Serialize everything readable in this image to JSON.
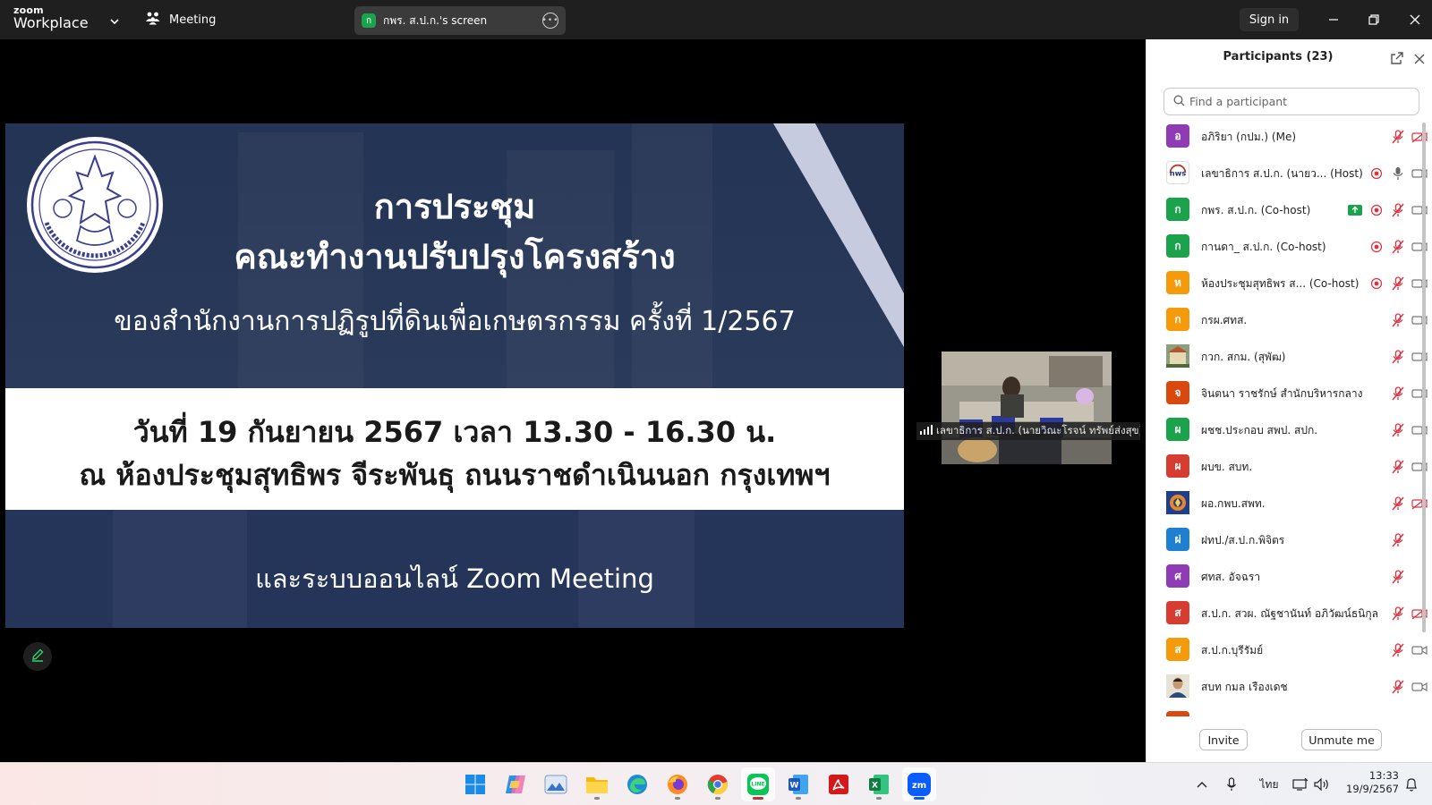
{
  "titlebar": {
    "brand_line1": "zoom",
    "brand_line2": "Workplace",
    "meeting_label": "Meeting",
    "share_avatar": "ก",
    "share_label": "กพร. ส.ป.ก.'s screen",
    "signin_label": "Sign in"
  },
  "slide": {
    "title_line1": "การประชุม",
    "title_line2": "คณะทำงานปรับปรุงโครงสร้าง",
    "subtitle": "ของสำนักงานการปฏิรูปที่ดินเพื่อเกษตรกรรม ครั้งที่ 1/2567",
    "date_line": "วันที่ 19 กันยายน 2567 เวลา 13.30 - 16.30 น.",
    "venue_line": "ณ ห้องประชุมสุทธิพร จีระพันธุ ถนนราชดำเนินนอก กรุงเทพฯ",
    "online_line": "และระบบออนไลน์ Zoom Meeting",
    "seal_caption": "สำนักงานการปฏิรูปที่ดินเพื่อเกษตรกรรม"
  },
  "thumbnail": {
    "name": "เลขาธิการ ส.ป.ก. (นายวิณะโรจน์ ทรัพย์ส่งสุข)"
  },
  "participants": {
    "title": "Participants (23)",
    "search_placeholder": "Find a participant",
    "invite_label": "Invite",
    "unmute_label": "Unmute me",
    "items": [
      {
        "initial": "อ",
        "color": "#8e3bb5",
        "name": "อภิริยา (กปม.) (Me)",
        "mic": "muted",
        "video": "off",
        "sharing": false,
        "recording": false
      },
      {
        "initial": "nws",
        "color": "#ffffff",
        "name": "เลขาธิการ ส.ป.ก. (นายว... (Host)",
        "mic": "on",
        "video": "on",
        "sharing": false,
        "recording": true
      },
      {
        "initial": "ก",
        "color": "#1aa34a",
        "name": "กพร. ส.ป.ก. (Co-host)",
        "mic": "muted",
        "video": "on",
        "sharing": true,
        "recording": true
      },
      {
        "initial": "ก",
        "color": "#1aa34a",
        "name": "กานดา_ ส.ป.ก. (Co-host)",
        "mic": "muted",
        "video": "on",
        "sharing": false,
        "recording": true
      },
      {
        "initial": "ห",
        "color": "#f59b0b",
        "name": "ห้องประชุมสุทธิพร ส... (Co-host)",
        "mic": "muted",
        "video": "on",
        "sharing": false,
        "recording": true
      },
      {
        "initial": "ก",
        "color": "#f59b0b",
        "name": "กรผ.ศทส.",
        "mic": "muted",
        "video": "on",
        "sharing": false,
        "recording": false
      },
      {
        "initial": "img-building",
        "color": "#6f8a6a",
        "name": "กวก. สกม. (สุพัฒ)",
        "mic": "muted",
        "video": "on",
        "sharing": false,
        "recording": false
      },
      {
        "initial": "จ",
        "color": "#d9480f",
        "name": "จินตนา ราชรักษ์ สำนักบริหารกลาง",
        "mic": "muted",
        "video": "on",
        "sharing": false,
        "recording": false
      },
      {
        "initial": "ผ",
        "color": "#1aa34a",
        "name": "ผชช.ประกอบ สพป. สปก.",
        "mic": "muted",
        "video": "on",
        "sharing": false,
        "recording": false
      },
      {
        "initial": "ผ",
        "color": "#d63c2f",
        "name": "ผบข. สบท.",
        "mic": "muted",
        "video": "on",
        "sharing": false,
        "recording": false
      },
      {
        "initial": "img-logo",
        "color": "#2a4a9a",
        "name": "ผอ.กพบ.สพท.",
        "mic": "muted",
        "video": "off",
        "sharing": false,
        "recording": false
      },
      {
        "initial": "ฝ",
        "color": "#1f7fd1",
        "name": "ฝทป./ส.ป.ก.พิจิตร",
        "mic": "muted",
        "video": "none",
        "sharing": false,
        "recording": false
      },
      {
        "initial": "ศ",
        "color": "#8e3bb5",
        "name": "ศทส. อัจฉรา",
        "mic": "muted",
        "video": "none",
        "sharing": false,
        "recording": false
      },
      {
        "initial": "ส",
        "color": "#d63c2f",
        "name": "ส.ป.ก. สวผ. ณัฐชานันท์ อภิวัฒน์ธนิกุล",
        "mic": "muted",
        "video": "off",
        "sharing": false,
        "recording": false
      },
      {
        "initial": "ส",
        "color": "#f59b0b",
        "name": "ส.ป.ก.บุรีรัมย์",
        "mic": "muted",
        "video": "on",
        "sharing": false,
        "recording": false
      },
      {
        "initial": "img-person",
        "color": "#c7b79a",
        "name": "สบท กมล เรืองเดช",
        "mic": "muted",
        "video": "on",
        "sharing": false,
        "recording": false
      }
    ]
  },
  "taskbar": {
    "apps": [
      "windows-start",
      "copilot",
      "photos",
      "file-explorer",
      "edge",
      "firefox",
      "chrome",
      "line",
      "word",
      "acrobat",
      "excel",
      "zoom"
    ],
    "lang": "ไทย",
    "time": "13:33",
    "date": "19/9/2567"
  }
}
